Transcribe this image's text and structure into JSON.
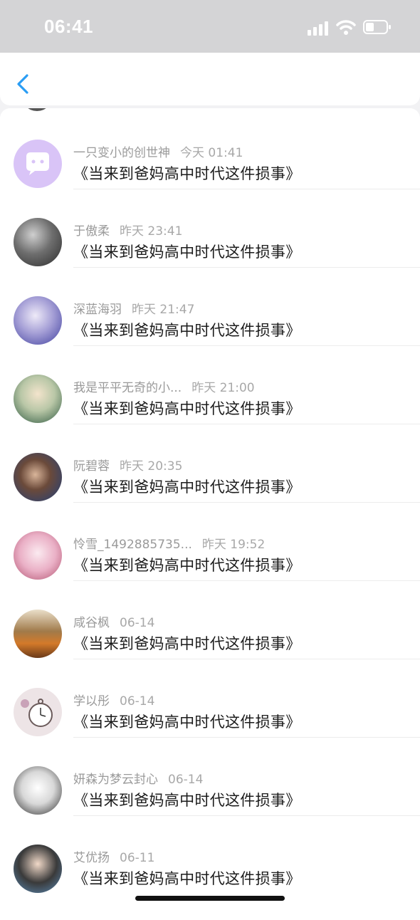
{
  "status_bar": {
    "time": "06:41"
  },
  "nav": {
    "back_icon": "chevron-left-icon"
  },
  "messages": [
    {
      "name": "一只变小的创世神",
      "time": "今天 01:41",
      "text": "《当来到爸妈高中时代这件损事》"
    },
    {
      "name": "于傲柔",
      "time": "昨天 23:41",
      "text": "《当来到爸妈高中时代这件损事》"
    },
    {
      "name": "深蓝海羽",
      "time": "昨天 21:47",
      "text": "《当来到爸妈高中时代这件损事》"
    },
    {
      "name": "我是平平无奇的小...",
      "time": "昨天 21:00",
      "text": "《当来到爸妈高中时代这件损事》"
    },
    {
      "name": "阮碧蓉",
      "time": "昨天 20:35",
      "text": "《当来到爸妈高中时代这件损事》"
    },
    {
      "name": "怜雪_1492885735...",
      "time": "昨天 19:52",
      "text": "《当来到爸妈高中时代这件损事》"
    },
    {
      "name": "咸谷枫",
      "time": "06-14",
      "text": "《当来到爸妈高中时代这件损事》"
    },
    {
      "name": "学以彤",
      "time": "06-14",
      "text": "《当来到爸妈高中时代这件损事》"
    },
    {
      "name": "妍森为梦云封心",
      "time": "06-14",
      "text": "《当来到爸妈高中时代这件损事》"
    },
    {
      "name": "艾优扬",
      "time": "06-11",
      "text": "《当来到爸妈高中时代这件损事》"
    }
  ],
  "colors": {
    "accent": "#2a9df4",
    "name_text": "#9a9a9a",
    "message_text": "#1c1c1c"
  }
}
